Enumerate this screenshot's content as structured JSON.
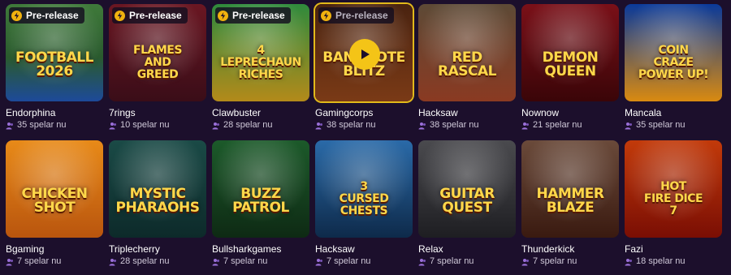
{
  "colors": {
    "background": "#1c0f2c",
    "badge_accent": "#f1b20e",
    "play_button": "#f4c417",
    "active_outline": "#e2b91a"
  },
  "player_icon": "users-icon",
  "badge_icon": "lightning-bolt-icon",
  "games": [
    {
      "provider": "Endorphina",
      "players": "35 spelar nu",
      "badge": "Pre-release",
      "art_title": "FOOTBALL\n2026",
      "bg": "linear-gradient(180deg,#3f7a3a 0%,#2a5a2e 55%,#1d4a9a 100%)"
    },
    {
      "provider": "7rings",
      "players": "10 spelar nu",
      "badge": "Pre-release",
      "art_title": "FLAMES\nand\nGREED",
      "bg": "linear-gradient(180deg,#6a1722 0%,#3a0d18 100%)"
    },
    {
      "provider": "Clawbuster",
      "players": "28 spelar nu",
      "badge": "Pre-release",
      "art_title": "4\nLEPRECHAUN\nRICHES",
      "bg": "linear-gradient(180deg,#2f8a3c 0%,#b38a1a 100%)"
    },
    {
      "provider": "Gamingcorps",
      "players": "38 spelar nu",
      "badge": "Pre-release",
      "art_title": "BANKNOTE\nBLITZ",
      "bg": "linear-gradient(180deg,#4a2310 0%,#7a3a16 100%)"
    },
    {
      "provider": "Hacksaw",
      "players": "38 spelar nu",
      "badge": "",
      "art_title": "RED\nRASCAL",
      "bg": "linear-gradient(180deg,#5d4a36 0%,#8a3a22 100%)"
    },
    {
      "provider": "Nownow",
      "players": "21 spelar nu",
      "badge": "",
      "art_title": "DEMON\nQUEEN",
      "bg": "linear-gradient(180deg,#7a1018 0%,#3a0508 100%)"
    },
    {
      "provider": "Mancala",
      "players": "35 spelar nu",
      "badge": "",
      "art_title": "COIN\nCRAZE\nPOWER UP!",
      "bg": "linear-gradient(180deg,#0a3a9a 0%,#d98a10 100%)"
    },
    {
      "provider": "Bgaming",
      "players": "7 spelar nu",
      "badge": "",
      "art_title": "CHICKEN\nSHOT",
      "bg": "linear-gradient(180deg,#e88a18 0%,#b9550e 100%)"
    },
    {
      "provider": "Triplecherry",
      "players": "28 spelar nu",
      "badge": "",
      "art_title": "MYSTIC\nPHARAOHS",
      "bg": "linear-gradient(180deg,#1a4a46 0%,#0d2a2a 100%)"
    },
    {
      "provider": "Bullsharkgames",
      "players": "7 spelar nu",
      "badge": "",
      "art_title": "BUZZ\nPATROL",
      "bg": "linear-gradient(180deg,#1c5a2a 0%,#0e2a14 100%)"
    },
    {
      "provider": "Hacksaw",
      "players": "7 spelar nu",
      "badge": "",
      "art_title": "3\nCURSED\nCHESTS",
      "bg": "linear-gradient(180deg,#2a6aa8 0%,#0e2a4a 100%)"
    },
    {
      "provider": "Relax",
      "players": "7 spelar nu",
      "badge": "",
      "art_title": "GUITAR\nQUEST",
      "bg": "linear-gradient(180deg,#4a4a4e 0%,#1e1e22 100%)"
    },
    {
      "provider": "Thunderkick",
      "players": "7 spelar nu",
      "badge": "",
      "art_title": "HAMMER\nBLAZE",
      "bg": "linear-gradient(180deg,#6a4a3a 0%,#3a1a10 100%)"
    },
    {
      "provider": "Fazi",
      "players": "18 spelar nu",
      "badge": "",
      "art_title": "HOT\nFIRE DICE\n7",
      "bg": "linear-gradient(180deg,#c23a0a 0%,#7a0e04 100%)"
    }
  ]
}
